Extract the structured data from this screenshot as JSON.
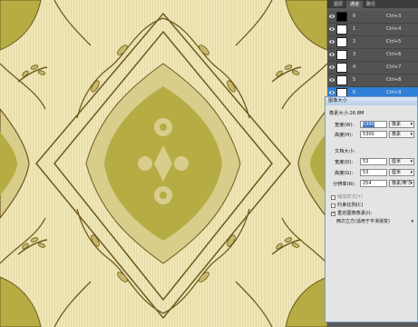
{
  "colors": {
    "bg": "#efe6b8",
    "motif": "#b5ad44",
    "outline": "#6e5a1e",
    "selected": "#2f80d6"
  },
  "panel": {
    "tabs": [
      "图层",
      "通道",
      "路径"
    ],
    "channels": [
      {
        "name": "0",
        "shortcut": "Ctrl+3"
      },
      {
        "name": "1",
        "shortcut": "Ctrl+4"
      },
      {
        "name": "2",
        "shortcut": "Ctrl+5"
      },
      {
        "name": "3",
        "shortcut": "Ctrl+6"
      },
      {
        "name": "4",
        "shortcut": "Ctrl+7"
      },
      {
        "name": "5",
        "shortcut": "Ctrl+8"
      },
      {
        "name": "6",
        "shortcut": "Ctrl+9"
      }
    ]
  },
  "dialog": {
    "title": "图像大小",
    "pixel_size": "像素大小:26.8M",
    "width_label": "宽度(W):",
    "width_value": "5300",
    "width_unit": "像素",
    "height_label": "高度(H):",
    "height_value": "5300",
    "height_unit": "像素",
    "doc_size": "文档大小:",
    "doc_width_label": "宽度(D):",
    "doc_width_value": "53",
    "doc_width_unit": "厘米",
    "doc_height_label": "高度(G):",
    "doc_height_value": "53",
    "doc_height_unit": "厘米",
    "res_label": "分辨率(R):",
    "res_value": "254",
    "res_unit": "像素/英寸",
    "scale_styles": "缩放样式(Y)",
    "constrain": "约束比例(C)",
    "resample": "重定图像像素(I):",
    "resample_method": "两次立方(适用于平滑渐变)"
  }
}
